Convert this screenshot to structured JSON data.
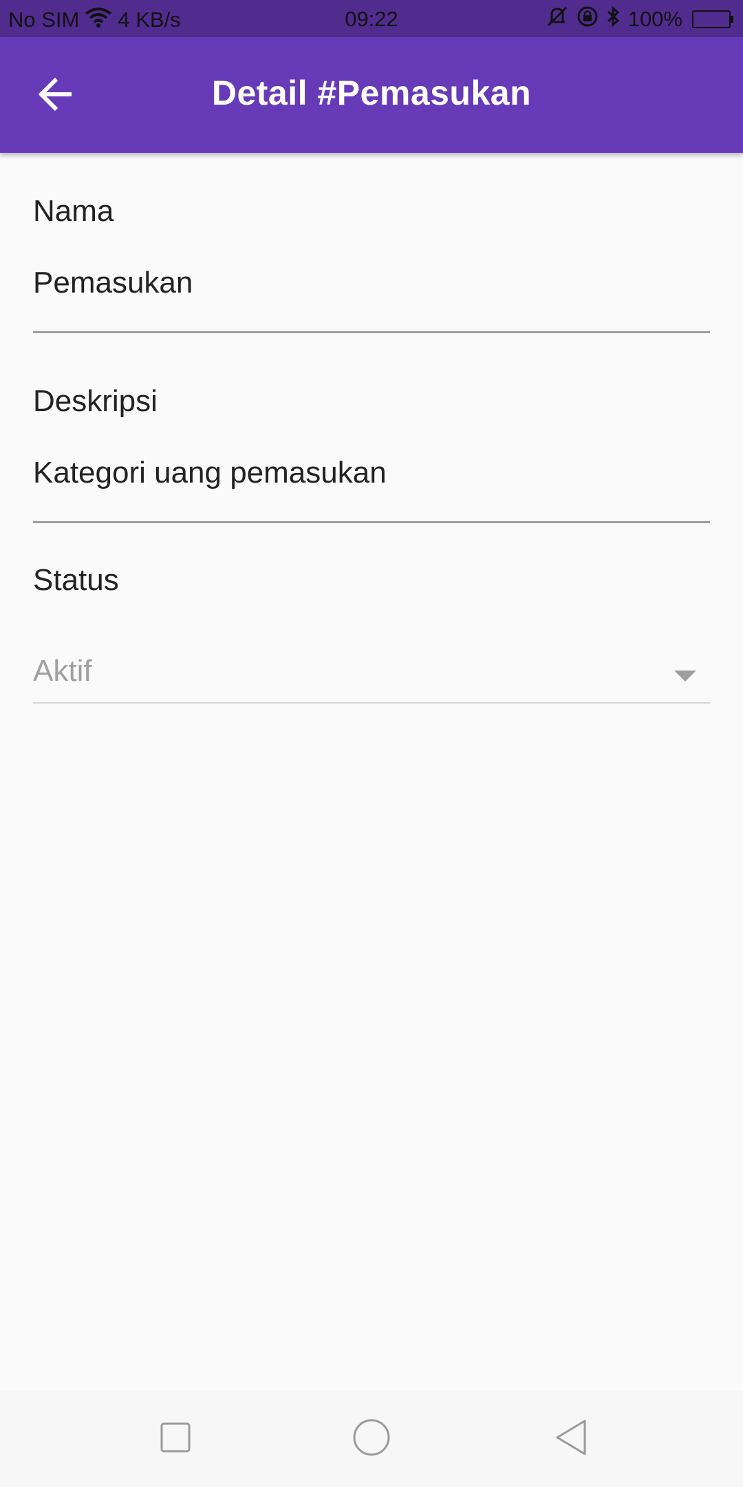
{
  "status_bar": {
    "carrier": "No SIM",
    "net_speed": "4 KB/s",
    "time": "09:22",
    "battery": "100%",
    "battery_level": 1.0,
    "icons": [
      "wifi-icon",
      "vibrate-off-icon",
      "rotation-lock-icon",
      "bluetooth-icon",
      "battery-icon"
    ]
  },
  "app_bar": {
    "title": "Detail #Pemasukan",
    "back_icon": "arrow-left-icon",
    "color": "#673ab7"
  },
  "form": {
    "nama": {
      "label": "Nama",
      "value": "Pemasukan"
    },
    "deskripsi": {
      "label": "Deskripsi",
      "value": "Kategori uang pemasukan"
    },
    "status": {
      "label": "Status",
      "selected": "Aktif",
      "icon": "caret-down-icon"
    }
  },
  "nav_bar": {
    "icons": [
      "recent-apps-icon",
      "home-icon",
      "back-icon"
    ]
  }
}
